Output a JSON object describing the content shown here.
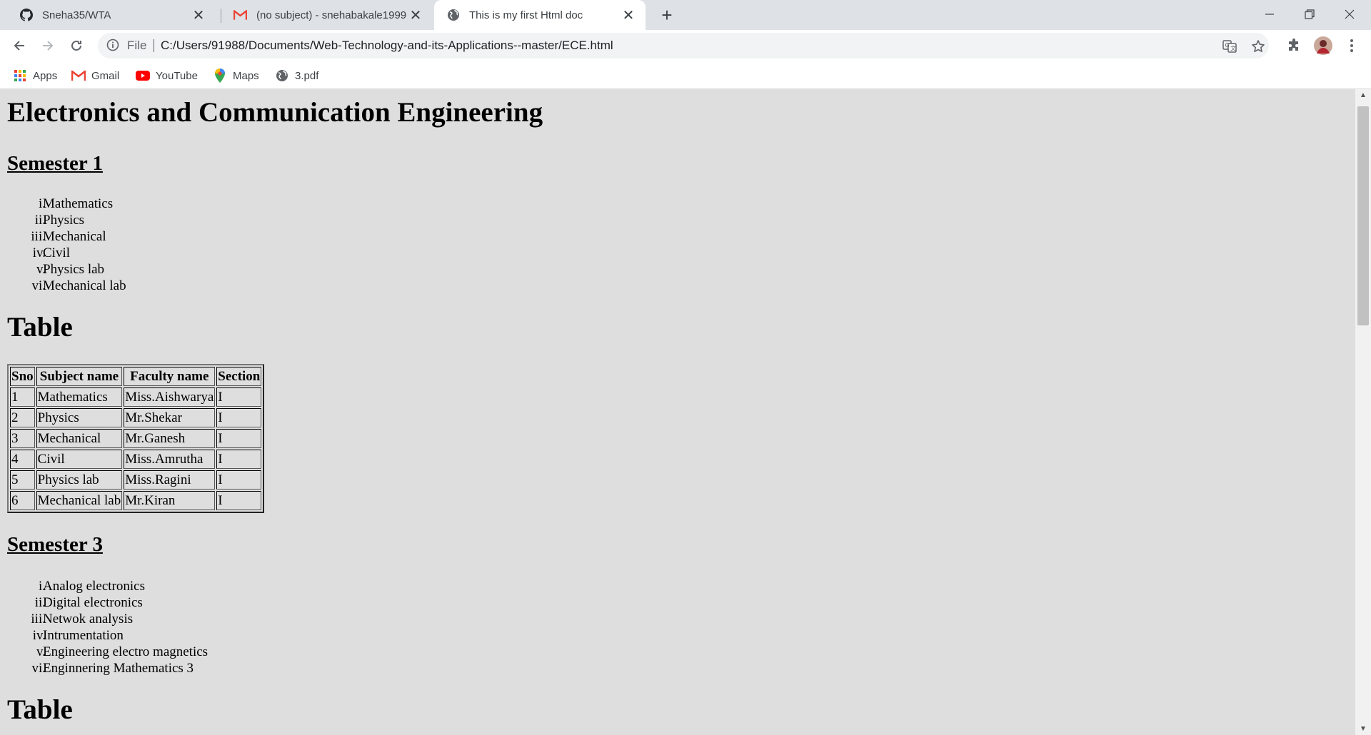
{
  "tabs": [
    {
      "title": "Sneha35/WTA",
      "icon": "github-icon"
    },
    {
      "title": "(no subject) - snehabakale1999@",
      "icon": "gmail-icon"
    },
    {
      "title": "This is my first Html doc",
      "icon": "globe-icon",
      "active": true
    }
  ],
  "toolbar": {
    "scheme_label": "File",
    "url": "C:/Users/91988/Documents/Web-Technology-and-its-Applications--master/ECE.html"
  },
  "bookmarks": [
    {
      "label": "Apps",
      "icon": "apps-grid-icon"
    },
    {
      "label": "Gmail",
      "icon": "gmail-icon"
    },
    {
      "label": "YouTube",
      "icon": "youtube-icon"
    },
    {
      "label": "Maps",
      "icon": "maps-pin-icon"
    },
    {
      "label": "3.pdf",
      "icon": "globe-icon"
    }
  ],
  "page": {
    "heading": "Electronics and Communication Engineering",
    "semester1": {
      "title": "Semester 1",
      "numerals": [
        "i.",
        "ii.",
        "iii.",
        "iv.",
        "v.",
        "vi."
      ],
      "subjects": [
        "Mathematics",
        "Physics",
        "Mechanical",
        "Civil",
        "Physics lab",
        "Mechanical lab"
      ]
    },
    "table1": {
      "title": "Table",
      "headers": [
        "Sno",
        "Subject name",
        "Faculty name",
        "Section"
      ],
      "rows": [
        [
          "1",
          "Mathematics",
          "Miss.Aishwarya",
          "I"
        ],
        [
          "2",
          "Physics",
          "Mr.Shekar",
          "I"
        ],
        [
          "3",
          "Mechanical",
          "Mr.Ganesh",
          "I"
        ],
        [
          "4",
          "Civil",
          "Miss.Amrutha",
          "I"
        ],
        [
          "5",
          "Physics lab",
          "Miss.Ragini",
          "I"
        ],
        [
          "6",
          "Mechanical lab",
          "Mr.Kiran",
          "I"
        ]
      ]
    },
    "semester3": {
      "title": "Semester 3",
      "numerals": [
        "i.",
        "ii.",
        "iii.",
        "iv.",
        "v.",
        "vi."
      ],
      "subjects": [
        "Analog electronics",
        "Digital electronics",
        "Netwok analysis",
        "Intrumentation",
        "Engineering electro magnetics",
        "Enginnering Mathematics 3"
      ]
    },
    "table2": {
      "title": "Table"
    }
  },
  "colors": {
    "tabstrip": "#dee1e6",
    "page_background": "#dedede",
    "gmail_red": "#ea4335",
    "youtube_red": "#ff0000"
  }
}
